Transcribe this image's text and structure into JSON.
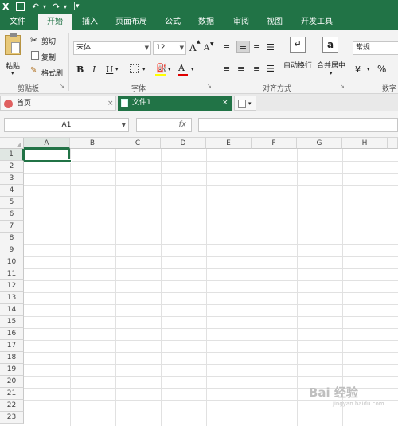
{
  "titlebar": {
    "app_icon": "X",
    "save_icon": "save-icon",
    "undo_symbol": "↶",
    "redo_symbol": "↷",
    "customize_symbol": "|▾"
  },
  "ribbon_tabs": [
    {
      "label": "文件"
    },
    {
      "label": "开始"
    },
    {
      "label": "插入"
    },
    {
      "label": "页面布局"
    },
    {
      "label": "公式"
    },
    {
      "label": "数据"
    },
    {
      "label": "审阅"
    },
    {
      "label": "视图"
    },
    {
      "label": "开发工具"
    }
  ],
  "clipboard": {
    "paste": "粘贴",
    "cut": "剪切",
    "copy": "复制",
    "format_painter": "格式刷",
    "group": "剪贴板"
  },
  "font": {
    "name": "宋体",
    "size": "12",
    "bold": "B",
    "italic": "I",
    "underline": "U",
    "group": "字体",
    "grow": "A",
    "shrink": "A",
    "font_color_letter": "A"
  },
  "alignment": {
    "wrap": "自动换行",
    "merge": "合并居中",
    "group": "对齐方式"
  },
  "number": {
    "format": "常规",
    "percent": "%",
    "group": "数字",
    "currency": "¥"
  },
  "doc_tabs": [
    {
      "label": "首页",
      "close": "×"
    },
    {
      "label": "文件1",
      "close": "×"
    }
  ],
  "formula_bar": {
    "name_box": "A1",
    "fx": "fx"
  },
  "columns": [
    "A",
    "B",
    "C",
    "D",
    "E",
    "F",
    "G",
    "H"
  ],
  "rows": [
    "1",
    "2",
    "3",
    "4",
    "5",
    "6",
    "7",
    "8",
    "9",
    "10",
    "11",
    "12",
    "13",
    "14",
    "15",
    "16",
    "17",
    "18",
    "19",
    "20",
    "21",
    "22",
    "23"
  ],
  "watermark": {
    "text": "Bai 经验",
    "sub": "jingyan.baidu.com"
  },
  "colors": {
    "accent": "#217346",
    "ribbon_bg": "#f3f3f3"
  }
}
